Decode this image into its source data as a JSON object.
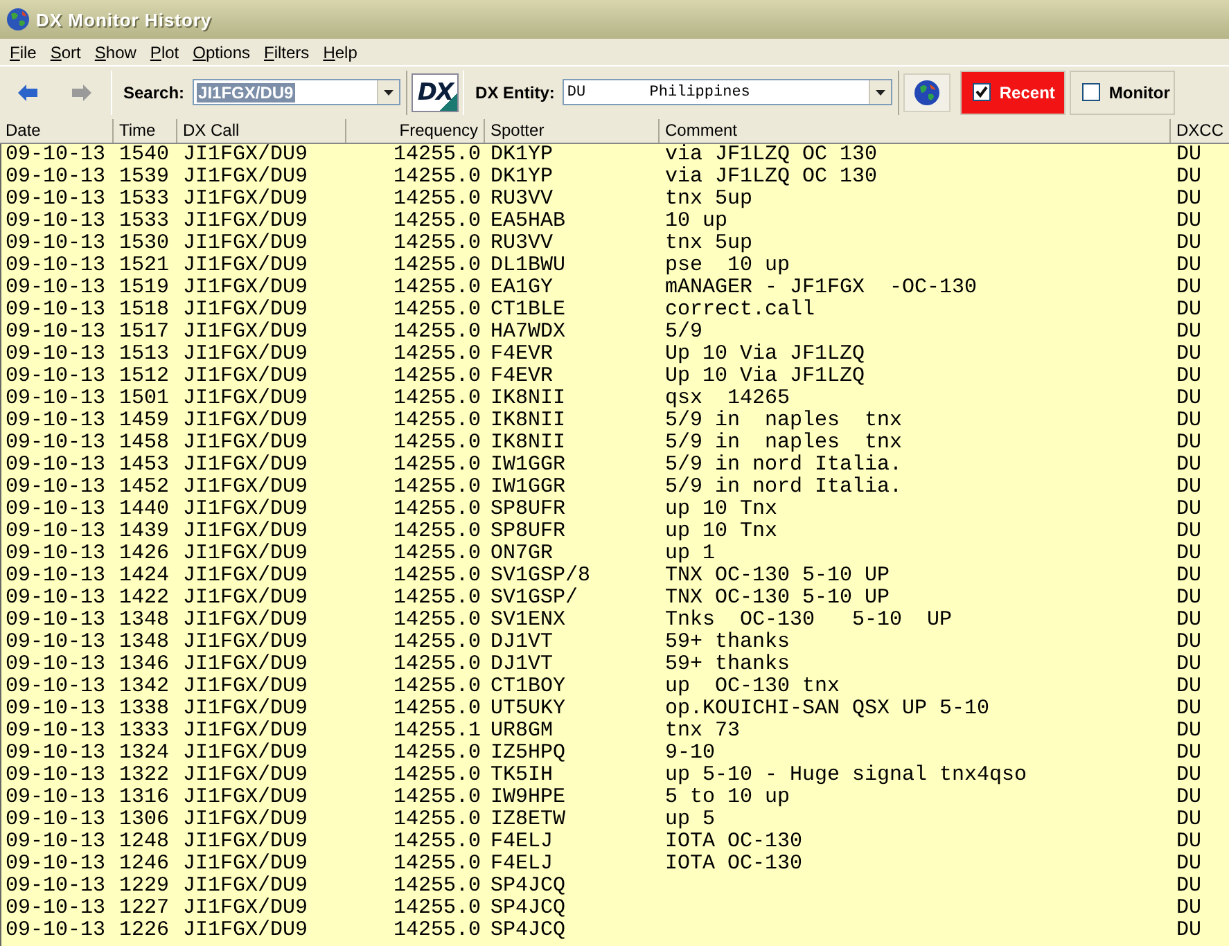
{
  "window": {
    "title": "DX Monitor History"
  },
  "menu": [
    "File",
    "Sort",
    "Show",
    "Plot",
    "Options",
    "Filters",
    "Help"
  ],
  "toolbar": {
    "nav": [
      {
        "kind": "back",
        "disabled": false
      },
      {
        "kind": "forward",
        "disabled": true
      }
    ],
    "search": {
      "label": "Search:",
      "value": "JI1FGX/DU9",
      "text_selected": true
    },
    "logo": "DX",
    "entity": {
      "label": "DX Entity:",
      "value": "DU       Philippines"
    },
    "toggles": [
      {
        "label": "Recent",
        "checked": true,
        "highlighted": true
      },
      {
        "label": "Monitor",
        "checked": false,
        "highlighted": false
      }
    ]
  },
  "table": {
    "columns": [
      "Date",
      "Time",
      "DX Call",
      "Frequency",
      "Spotter",
      "Comment",
      "DXCC"
    ],
    "rows": [
      {
        "date": "09-10-13",
        "time": "1540",
        "dx_call": "JI1FGX/DU9",
        "frequency": "14255.0",
        "spotter": "DK1YP",
        "comment": "via JF1LZQ OC 130",
        "dxcc": "DU"
      },
      {
        "date": "09-10-13",
        "time": "1539",
        "dx_call": "JI1FGX/DU9",
        "frequency": "14255.0",
        "spotter": "DK1YP",
        "comment": "via JF1LZQ OC 130",
        "dxcc": "DU"
      },
      {
        "date": "09-10-13",
        "time": "1533",
        "dx_call": "JI1FGX/DU9",
        "frequency": "14255.0",
        "spotter": "RU3VV",
        "comment": "tnx 5up",
        "dxcc": "DU"
      },
      {
        "date": "09-10-13",
        "time": "1533",
        "dx_call": "JI1FGX/DU9",
        "frequency": "14255.0",
        "spotter": "EA5HAB",
        "comment": "10 up",
        "dxcc": "DU"
      },
      {
        "date": "09-10-13",
        "time": "1530",
        "dx_call": "JI1FGX/DU9",
        "frequency": "14255.0",
        "spotter": "RU3VV",
        "comment": "tnx 5up",
        "dxcc": "DU"
      },
      {
        "date": "09-10-13",
        "time": "1521",
        "dx_call": "JI1FGX/DU9",
        "frequency": "14255.0",
        "spotter": "DL1BWU",
        "comment": "pse  10 up",
        "dxcc": "DU"
      },
      {
        "date": "09-10-13",
        "time": "1519",
        "dx_call": "JI1FGX/DU9",
        "frequency": "14255.0",
        "spotter": "EA1GY",
        "comment": "mANAGER - JF1FGX  -OC-130",
        "dxcc": "DU"
      },
      {
        "date": "09-10-13",
        "time": "1518",
        "dx_call": "JI1FGX/DU9",
        "frequency": "14255.0",
        "spotter": "CT1BLE",
        "comment": "correct.call",
        "dxcc": "DU"
      },
      {
        "date": "09-10-13",
        "time": "1517",
        "dx_call": "JI1FGX/DU9",
        "frequency": "14255.0",
        "spotter": "HA7WDX",
        "comment": "5/9",
        "dxcc": "DU"
      },
      {
        "date": "09-10-13",
        "time": "1513",
        "dx_call": "JI1FGX/DU9",
        "frequency": "14255.0",
        "spotter": "F4EVR",
        "comment": "Up 10 Via JF1LZQ",
        "dxcc": "DU"
      },
      {
        "date": "09-10-13",
        "time": "1512",
        "dx_call": "JI1FGX/DU9",
        "frequency": "14255.0",
        "spotter": "F4EVR",
        "comment": "Up 10 Via JF1LZQ",
        "dxcc": "DU"
      },
      {
        "date": "09-10-13",
        "time": "1501",
        "dx_call": "JI1FGX/DU9",
        "frequency": "14255.0",
        "spotter": "IK8NII",
        "comment": "qsx  14265",
        "dxcc": "DU"
      },
      {
        "date": "09-10-13",
        "time": "1459",
        "dx_call": "JI1FGX/DU9",
        "frequency": "14255.0",
        "spotter": "IK8NII",
        "comment": "5/9 in  naples  tnx",
        "dxcc": "DU"
      },
      {
        "date": "09-10-13",
        "time": "1458",
        "dx_call": "JI1FGX/DU9",
        "frequency": "14255.0",
        "spotter": "IK8NII",
        "comment": "5/9 in  naples  tnx",
        "dxcc": "DU"
      },
      {
        "date": "09-10-13",
        "time": "1453",
        "dx_call": "JI1FGX/DU9",
        "frequency": "14255.0",
        "spotter": "IW1GGR",
        "comment": "5/9 in nord Italia.",
        "dxcc": "DU"
      },
      {
        "date": "09-10-13",
        "time": "1452",
        "dx_call": "JI1FGX/DU9",
        "frequency": "14255.0",
        "spotter": "IW1GGR",
        "comment": "5/9 in nord Italia.",
        "dxcc": "DU"
      },
      {
        "date": "09-10-13",
        "time": "1440",
        "dx_call": "JI1FGX/DU9",
        "frequency": "14255.0",
        "spotter": "SP8UFR",
        "comment": "up 10 Tnx",
        "dxcc": "DU"
      },
      {
        "date": "09-10-13",
        "time": "1439",
        "dx_call": "JI1FGX/DU9",
        "frequency": "14255.0",
        "spotter": "SP8UFR",
        "comment": "up 10 Tnx",
        "dxcc": "DU"
      },
      {
        "date": "09-10-13",
        "time": "1426",
        "dx_call": "JI1FGX/DU9",
        "frequency": "14255.0",
        "spotter": "ON7GR",
        "comment": "up 1",
        "dxcc": "DU"
      },
      {
        "date": "09-10-13",
        "time": "1424",
        "dx_call": "JI1FGX/DU9",
        "frequency": "14255.0",
        "spotter": "SV1GSP/8",
        "comment": "TNX OC-130 5-10 UP",
        "dxcc": "DU"
      },
      {
        "date": "09-10-13",
        "time": "1422",
        "dx_call": "JI1FGX/DU9",
        "frequency": "14255.0",
        "spotter": "SV1GSP/",
        "comment": "TNX OC-130 5-10 UP",
        "dxcc": "DU"
      },
      {
        "date": "09-10-13",
        "time": "1348",
        "dx_call": "JI1FGX/DU9",
        "frequency": "14255.0",
        "spotter": "SV1ENX",
        "comment": "Tnks  OC-130   5-10  UP",
        "dxcc": "DU"
      },
      {
        "date": "09-10-13",
        "time": "1348",
        "dx_call": "JI1FGX/DU9",
        "frequency": "14255.0",
        "spotter": "DJ1VT",
        "comment": "59+ thanks",
        "dxcc": "DU"
      },
      {
        "date": "09-10-13",
        "time": "1346",
        "dx_call": "JI1FGX/DU9",
        "frequency": "14255.0",
        "spotter": "DJ1VT",
        "comment": "59+ thanks",
        "dxcc": "DU"
      },
      {
        "date": "09-10-13",
        "time": "1342",
        "dx_call": "JI1FGX/DU9",
        "frequency": "14255.0",
        "spotter": "CT1BOY",
        "comment": "up  OC-130 tnx",
        "dxcc": "DU"
      },
      {
        "date": "09-10-13",
        "time": "1338",
        "dx_call": "JI1FGX/DU9",
        "frequency": "14255.0",
        "spotter": "UT5UKY",
        "comment": "op.KOUICHI-SAN QSX UP 5-10",
        "dxcc": "DU"
      },
      {
        "date": "09-10-13",
        "time": "1333",
        "dx_call": "JI1FGX/DU9",
        "frequency": "14255.1",
        "spotter": "UR8GM",
        "comment": "tnx 73",
        "dxcc": "DU"
      },
      {
        "date": "09-10-13",
        "time": "1324",
        "dx_call": "JI1FGX/DU9",
        "frequency": "14255.0",
        "spotter": "IZ5HPQ",
        "comment": "9-10",
        "dxcc": "DU"
      },
      {
        "date": "09-10-13",
        "time": "1322",
        "dx_call": "JI1FGX/DU9",
        "frequency": "14255.0",
        "spotter": "TK5IH",
        "comment": "up 5-10 - Huge signal tnx4qso",
        "dxcc": "DU"
      },
      {
        "date": "09-10-13",
        "time": "1316",
        "dx_call": "JI1FGX/DU9",
        "frequency": "14255.0",
        "spotter": "IW9HPE",
        "comment": "5 to 10 up",
        "dxcc": "DU"
      },
      {
        "date": "09-10-13",
        "time": "1306",
        "dx_call": "JI1FGX/DU9",
        "frequency": "14255.0",
        "spotter": "IZ8ETW",
        "comment": "up 5",
        "dxcc": "DU"
      },
      {
        "date": "09-10-13",
        "time": "1248",
        "dx_call": "JI1FGX/DU9",
        "frequency": "14255.0",
        "spotter": "F4ELJ",
        "comment": "IOTA OC-130",
        "dxcc": "DU"
      },
      {
        "date": "09-10-13",
        "time": "1246",
        "dx_call": "JI1FGX/DU9",
        "frequency": "14255.0",
        "spotter": "F4ELJ",
        "comment": "IOTA OC-130",
        "dxcc": "DU"
      },
      {
        "date": "09-10-13",
        "time": "1229",
        "dx_call": "JI1FGX/DU9",
        "frequency": "14255.0",
        "spotter": "SP4JCQ",
        "dxcc": "DU"
      },
      {
        "date": "09-10-13",
        "time": "1227",
        "dx_call": "JI1FGX/DU9",
        "frequency": "14255.0",
        "spotter": "SP4JCQ",
        "dxcc": "DU"
      },
      {
        "date": "09-10-13",
        "time": "1226",
        "dx_call": "JI1FGX/DU9",
        "frequency": "14255.0",
        "spotter": "SP4JCQ",
        "dxcc": "DU"
      }
    ]
  }
}
